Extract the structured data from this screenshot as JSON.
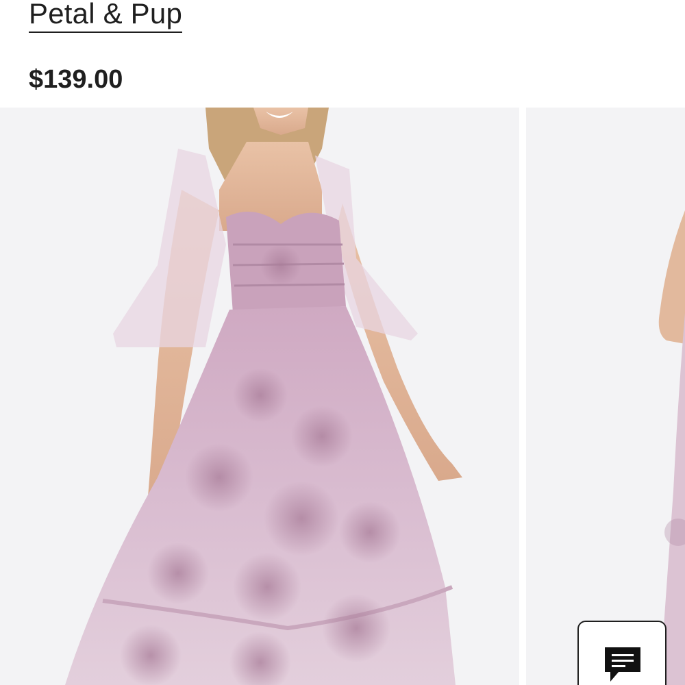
{
  "product": {
    "brand": "Petal & Pup",
    "price": "$139.00"
  },
  "gallery": {
    "images": [
      {
        "alt": "product-photo-1"
      },
      {
        "alt": "product-photo-2"
      }
    ]
  },
  "chat": {
    "icon": "chat-bubble-icon"
  },
  "colors": {
    "text": "#1f1f1f",
    "photo_bg": "#f3f3f5",
    "dress_pink": "#d9b8cc",
    "dress_mauve": "#b58aa5"
  }
}
